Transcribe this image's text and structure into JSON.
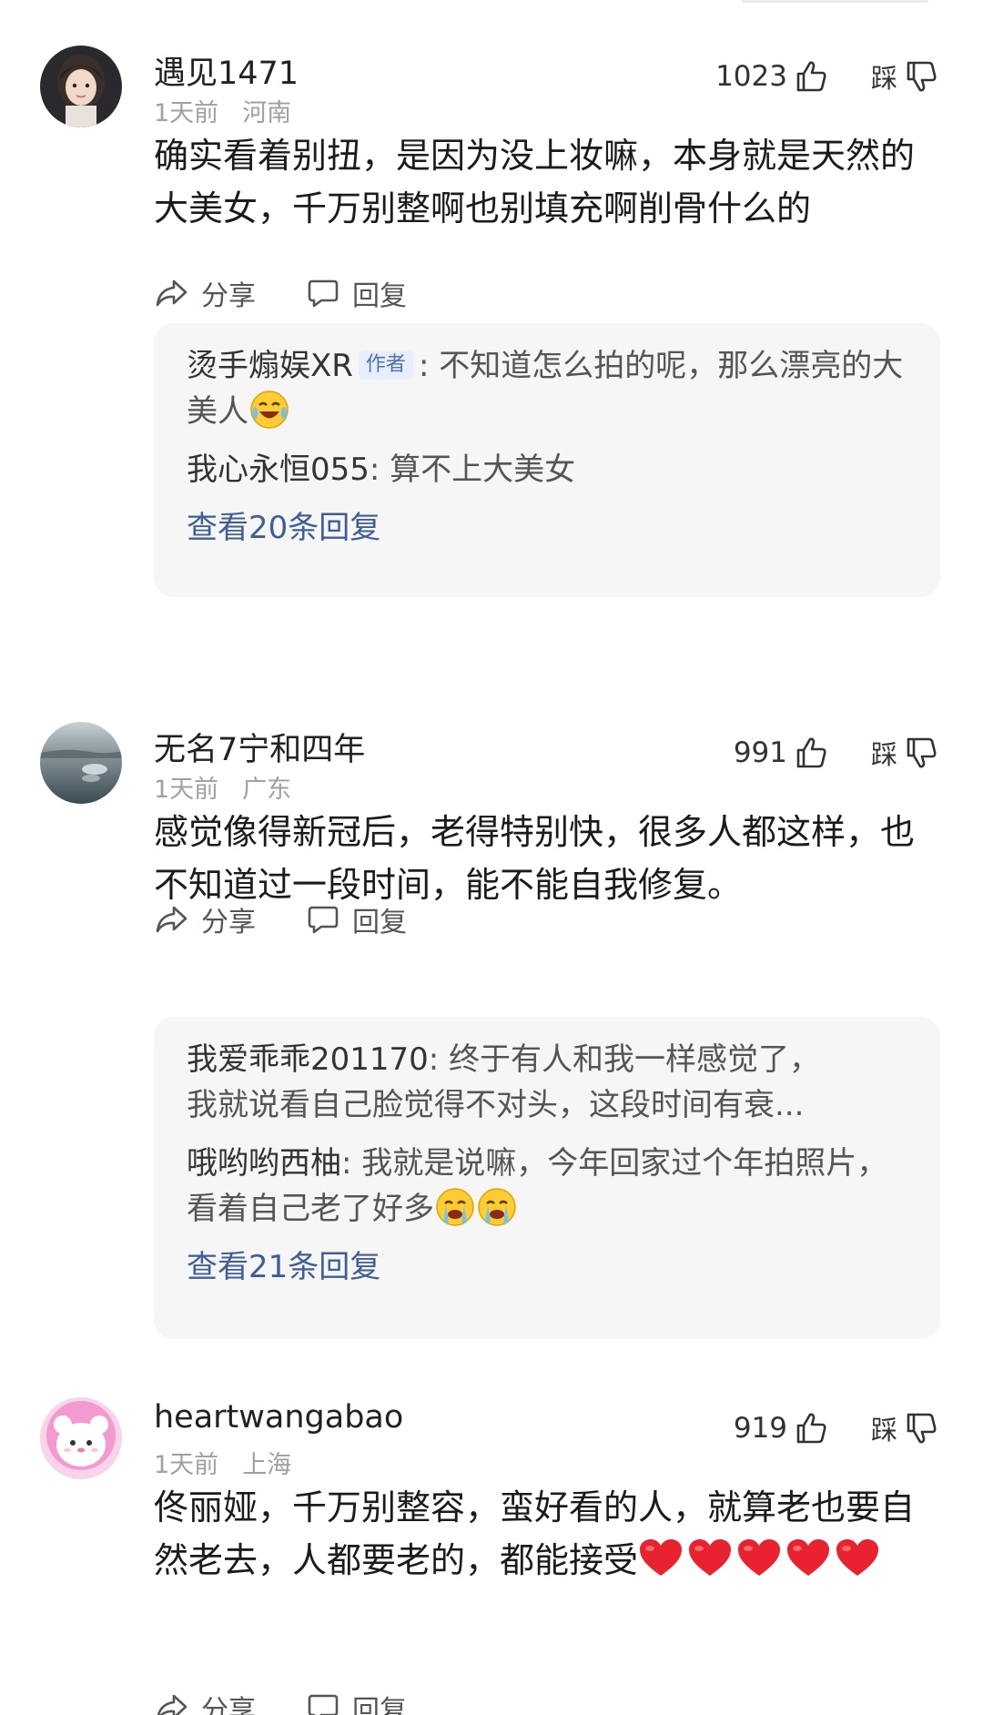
{
  "comments": [
    {
      "username": "遇见1471",
      "time": "1天前",
      "location": "河南",
      "likes": "1023",
      "dislike_label": "踩",
      "text": "确实看着别扭，是因为没上妆嘛，本身就是天然的大美女，千万别整啊也别填充啊削骨什么的",
      "share_label": "分享",
      "reply_label": "回复",
      "replies": [
        {
          "name": "烫手煽娱XR",
          "tag": "作者",
          "sep": ": ",
          "text": "不知道怎么拍的呢，那么漂亮的大美人",
          "emojis": [
            "crying-laughing-emoji"
          ]
        },
        {
          "name": "我心永恒055",
          "sep": ": ",
          "text": "算不上大美女"
        }
      ],
      "view_more": "查看20条回复"
    },
    {
      "username": "无名7宁和四年",
      "time": "1天前",
      "location": "广东",
      "likes": "991",
      "dislike_label": "踩",
      "text": "感觉像得新冠后，老得特别快，很多人都这样，也不知道过一段时间，能不能自我修复。",
      "share_label": "分享",
      "reply_label": "回复",
      "replies": [
        {
          "name": "我爱乖乖201170",
          "sep": ": ",
          "text_line1": "终于有人和我一样感觉了，",
          "text_line2": "我就说看自己脸觉得不对头，这段时间有衰..."
        },
        {
          "name": "哦哟哟西柚",
          "sep": ": ",
          "text": "我就是说嘛，今年回家过个年拍照片，看着自己老了好多",
          "emojis": [
            "crying-emoji",
            "crying-emoji"
          ]
        }
      ],
      "view_more": "查看21条回复"
    },
    {
      "username": "heartwangabao",
      "time": "1天前",
      "location": "上海",
      "likes": "919",
      "dislike_label": "踩",
      "text": "佟丽娅，千万别整容，蛮好看的人，就算老也要自然老去，人都要老的，都能接受",
      "emojis": [
        "red-heart-emoji",
        "red-heart-emoji",
        "red-heart-emoji",
        "red-heart-emoji",
        "red-heart-emoji"
      ],
      "share_label": "分享",
      "reply_label": "回复"
    }
  ],
  "colors": {
    "link": "#3f5d96",
    "meta": "#a0a0a0",
    "reply_bg": "#f6f6f6",
    "author_tag_bg": "#e8eefb",
    "author_tag_text": "#4d71b8",
    "heart": "#e8222e"
  }
}
